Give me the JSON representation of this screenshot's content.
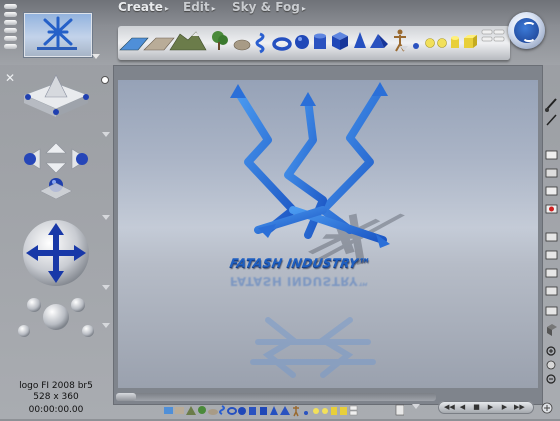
{
  "menu": {
    "tabs": [
      {
        "label": "Create"
      },
      {
        "label": "Edit"
      },
      {
        "label": "Sky & Fog"
      }
    ]
  },
  "toolbar_icons": [
    "water-plane-icon",
    "stone-plane-icon",
    "mountain-terrain-icon",
    "tree-icon",
    "rock-icon",
    "spiral-icon",
    "torus-icon",
    "sphere-icon",
    "cylinder-icon",
    "cube-icon",
    "cone-icon",
    "pyramid-icon",
    "figure-icon",
    "small-sphere-icon",
    "bulb-icon",
    "cylinder-yellow-icon",
    "cube-yellow-icon"
  ],
  "scene": {
    "logo_text": "FATASH INDUSTRY™",
    "accent": "#2f7fe0",
    "reflection_color": "#6f97cf"
  },
  "status": {
    "name": "logo FI 2008 br5",
    "dimensions": "528 x 360",
    "time": "00:00:00.00"
  },
  "colors": {
    "chrome": "#8b8e94",
    "shelf": "#e6e8eb",
    "viewport_border": "#6a6e75"
  }
}
